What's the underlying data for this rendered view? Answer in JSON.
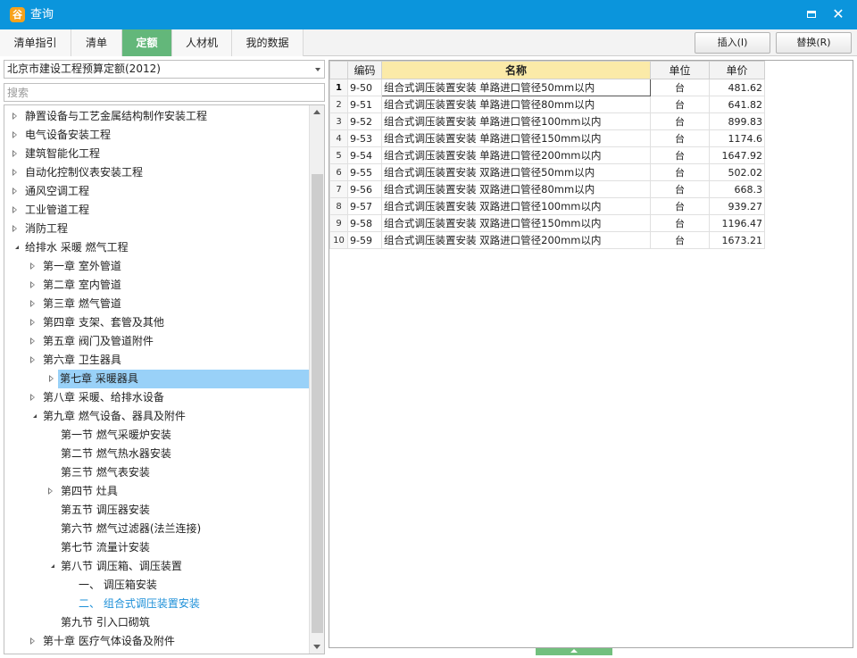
{
  "window": {
    "icon": "app-logo-icon",
    "icon_glyph": "谷",
    "title": "查询",
    "maximize_icon": "maximize-icon",
    "close_icon": "close-icon",
    "close_glyph": "✕"
  },
  "tabs": [
    {
      "label": "清单指引",
      "active": false
    },
    {
      "label": "清单",
      "active": false
    },
    {
      "label": "定额",
      "active": true
    },
    {
      "label": "人材机",
      "active": false
    },
    {
      "label": "我的数据",
      "active": false
    }
  ],
  "toolbar": {
    "insert_label": "插入(I)",
    "replace_label": "替换(R)"
  },
  "left": {
    "quota_library": "北京市建设工程预算定额(2012)",
    "search_placeholder": "搜索",
    "tree": [
      {
        "label": "静置设备与工艺金属结构制作安装工程",
        "level": 0,
        "state": "closed"
      },
      {
        "label": "电气设备安装工程",
        "level": 0,
        "state": "closed"
      },
      {
        "label": "建筑智能化工程",
        "level": 0,
        "state": "closed"
      },
      {
        "label": "自动化控制仪表安装工程",
        "level": 0,
        "state": "closed"
      },
      {
        "label": "通风空调工程",
        "level": 0,
        "state": "closed"
      },
      {
        "label": "工业管道工程",
        "level": 0,
        "state": "closed"
      },
      {
        "label": "消防工程",
        "level": 0,
        "state": "closed"
      },
      {
        "label": "给排水 采暖 燃气工程",
        "level": 0,
        "state": "open"
      },
      {
        "label": "第一章 室外管道",
        "level": 1,
        "state": "closed"
      },
      {
        "label": "第二章 室内管道",
        "level": 1,
        "state": "closed"
      },
      {
        "label": "第三章 燃气管道",
        "level": 1,
        "state": "closed"
      },
      {
        "label": "第四章 支架、套管及其他",
        "level": 1,
        "state": "closed"
      },
      {
        "label": "第五章 阀门及管道附件",
        "level": 1,
        "state": "closed"
      },
      {
        "label": "第六章 卫生器具",
        "level": 1,
        "state": "closed"
      },
      {
        "label": "第七章 采暖器具",
        "level": 1,
        "state": "closed",
        "selected": true
      },
      {
        "label": "第八章 采暖、给排水设备",
        "level": 1,
        "state": "closed"
      },
      {
        "label": "第九章 燃气设备、器具及附件",
        "level": 1,
        "state": "open"
      },
      {
        "label": "第一节 燃气采暖炉安装",
        "level": 2,
        "state": "leaf"
      },
      {
        "label": "第二节 燃气热水器安装",
        "level": 2,
        "state": "leaf"
      },
      {
        "label": "第三节 燃气表安装",
        "level": 2,
        "state": "leaf"
      },
      {
        "label": "第四节 灶具",
        "level": 2,
        "state": "closed"
      },
      {
        "label": "第五节 调压器安装",
        "level": 2,
        "state": "leaf"
      },
      {
        "label": "第六节 燃气过滤器(法兰连接)",
        "level": 2,
        "state": "leaf"
      },
      {
        "label": "第七节 流量计安装",
        "level": 2,
        "state": "leaf"
      },
      {
        "label": "第八节 调压箱、调压装置",
        "level": 2,
        "state": "open"
      },
      {
        "label": "一、 调压箱安装",
        "level": 3,
        "state": "leaf"
      },
      {
        "label": "二、 组合式调压装置安装",
        "level": 3,
        "state": "leaf",
        "highlight": true
      },
      {
        "label": "第九节 引入口砌筑",
        "level": 2,
        "state": "leaf"
      },
      {
        "label": "第十章 医疗气体设备及附件",
        "level": 1,
        "state": "closed"
      }
    ]
  },
  "grid": {
    "columns": {
      "code": "编码",
      "name": "名称",
      "unit": "单位",
      "price": "单价"
    },
    "rows": [
      {
        "idx": "1",
        "code": "9-50",
        "name": "组合式调压装置安装 单路进口管径50mm以内",
        "unit": "台",
        "price": "481.62"
      },
      {
        "idx": "2",
        "code": "9-51",
        "name": "组合式调压装置安装 单路进口管径80mm以内",
        "unit": "台",
        "price": "641.82"
      },
      {
        "idx": "3",
        "code": "9-52",
        "name": "组合式调压装置安装 单路进口管径100mm以内",
        "unit": "台",
        "price": "899.83"
      },
      {
        "idx": "4",
        "code": "9-53",
        "name": "组合式调压装置安装 单路进口管径150mm以内",
        "unit": "台",
        "price": "1174.6"
      },
      {
        "idx": "5",
        "code": "9-54",
        "name": "组合式调压装置安装 单路进口管径200mm以内",
        "unit": "台",
        "price": "1647.92"
      },
      {
        "idx": "6",
        "code": "9-55",
        "name": "组合式调压装置安装 双路进口管径50mm以内",
        "unit": "台",
        "price": "502.02"
      },
      {
        "idx": "7",
        "code": "9-56",
        "name": "组合式调压装置安装 双路进口管径80mm以内",
        "unit": "台",
        "price": "668.3"
      },
      {
        "idx": "8",
        "code": "9-57",
        "name": "组合式调压装置安装 双路进口管径100mm以内",
        "unit": "台",
        "price": "939.27"
      },
      {
        "idx": "9",
        "code": "9-58",
        "name": "组合式调压装置安装 双路进口管径150mm以内",
        "unit": "台",
        "price": "1196.47"
      },
      {
        "idx": "10",
        "code": "9-59",
        "name": "组合式调压装置安装 双路进口管径200mm以内",
        "unit": "台",
        "price": "1673.21"
      }
    ]
  },
  "colors": {
    "titlebar": "#0b95dc",
    "active_tab": "#63b77a",
    "tree_selected": "#99d1f8",
    "tree_highlight_text": "#1e90d8",
    "name_header": "#fbeaa8"
  }
}
